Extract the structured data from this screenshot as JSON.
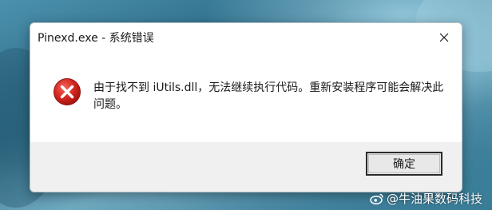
{
  "window": {
    "title": "Pinexd.exe - 系统错误",
    "close_icon": "close-icon"
  },
  "message": {
    "icon": "error-icon",
    "text": "由于找不到 iUtils.dll，无法继续执行代码。重新安装程序可能会解决此问题。"
  },
  "buttons": {
    "ok_label": "确定"
  },
  "watermark": {
    "icon": "weibo-icon",
    "text": "@牛油果数码科技"
  },
  "colors": {
    "error_red": "#d32f2f",
    "dialog_bg": "#f0f0f0",
    "content_bg": "#ffffff"
  }
}
